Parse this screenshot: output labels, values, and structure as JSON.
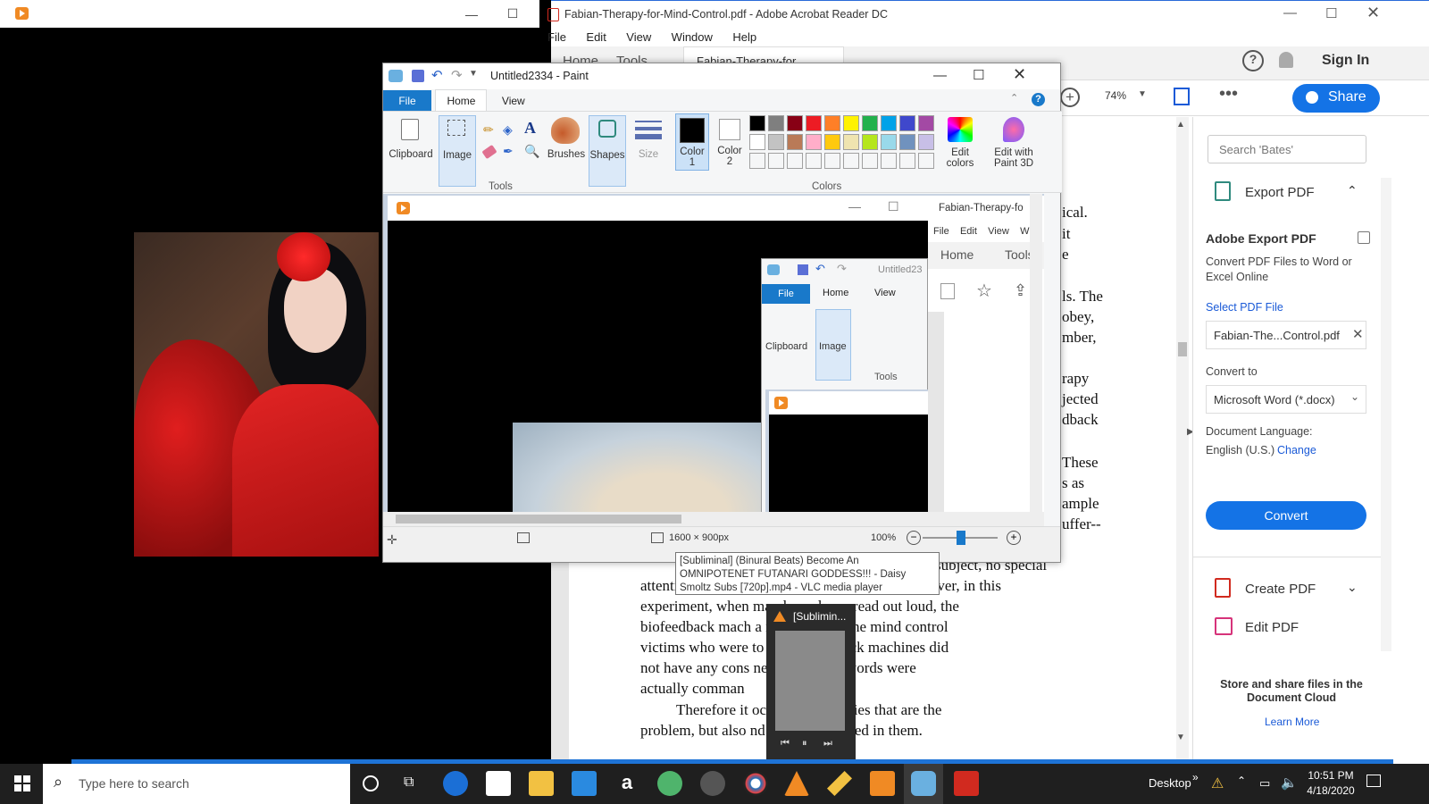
{
  "vlc_left": {
    "minimize": "—",
    "maximize": "☐"
  },
  "acrobat": {
    "title": "Fabian-Therapy-for-Mind-Control.pdf - Adobe Acrobat Reader DC",
    "menu": [
      "File",
      "Edit",
      "View",
      "Window",
      "Help"
    ],
    "tabs": {
      "home": "Home",
      "tools": "Tools",
      "doc": "Fabian-Therapy-for..."
    },
    "sign_in": "Sign In",
    "zoom": "74%",
    "share": "Share",
    "search_placeholder": "Search 'Bates'",
    "export_pdf": "Export PDF",
    "adobe_export_title": "Adobe Export PDF",
    "convert_desc": "Convert PDF Files to Word or Excel Online",
    "select_pdf": "Select PDF File",
    "selected_file": "Fabian-The...Control.pdf",
    "convert_to": "Convert to",
    "format": "Microsoft Word (*.docx)",
    "doc_language": "Document Language:",
    "language": "English (U.S.)",
    "change": "Change",
    "convert": "Convert",
    "create_pdf": "Create PDF",
    "edit_pdf": "Edit PDF",
    "store_share": "Store and share files in the Document Cloud",
    "learn_more": "Learn More",
    "text_right": [
      "ical.",
      "it",
      "e",
      "ls. The",
      "obey,",
      "mber,",
      "rapy",
      "jected",
      "dback",
      "These",
      "s as",
      "ample",
      "uffer--"
    ],
    "text_lines": [
      "subject, no special",
      "attention was paid to the command words. However, in this",
      "experiment, when        mand word was read out loud, the",
      "biofeedback mach          a reaction. But the mind control",
      "victims who were          to the biofeedback machines did",
      "not have any cons          ness that those words were",
      "actually comman",
      "Therefore it           occluded memories that are the",
      "problem, but also          nd words contained in them."
    ]
  },
  "paint": {
    "title": "Untitled2334 - Paint",
    "tabs": {
      "file": "File",
      "home": "Home",
      "view": "View"
    },
    "clipboard": "Clipboard",
    "image": "Image",
    "tools": "Tools",
    "brushes": "Brushes",
    "shapes": "Shapes",
    "size": "Size",
    "color1": "Color 1",
    "color2": "Color 2",
    "colors": "Colors",
    "edit_colors": "Edit colors",
    "edit_paint3d": "Edit with Paint 3D",
    "status_size": "1600 × 900px",
    "zoom": "100%",
    "palette": [
      "#000000",
      "#7f7f7f",
      "#880015",
      "#ed1c24",
      "#ff7f27",
      "#fff200",
      "#22b14c",
      "#00a2e8",
      "#3f48cc",
      "#a349a4",
      "#ffffff",
      "#c3c3c3",
      "#b97a57",
      "#ffaec9",
      "#ffc90e",
      "#efe4b0",
      "#b5e61d",
      "#99d9ea",
      "#7092be",
      "#c8bfe7"
    ]
  },
  "nested": {
    "acrobat_title": "Fabian-Therapy-fo",
    "menu": [
      "File",
      "Edit",
      "View",
      "W"
    ],
    "home": "Home",
    "tools": "Tools",
    "paint_title": "Untitled23",
    "file": "File",
    "home_tab": "Home",
    "view": "View",
    "clipboard": "Clipboard",
    "image": "Image",
    "tools_grp": "Tools"
  },
  "tooltip": "[Subliminal] (Binural Beats) Become An OMNIPOTENET FUTANARI GODDESS!!! - Daisy Smoltz Subs [720p].mp4 - VLC media player",
  "vlc_thumb": {
    "title": "[Sublimin..."
  },
  "taskbar": {
    "search": "Type here to search",
    "desktop": "Desktop",
    "time": "10:51 PM",
    "date": "4/18/2020"
  }
}
